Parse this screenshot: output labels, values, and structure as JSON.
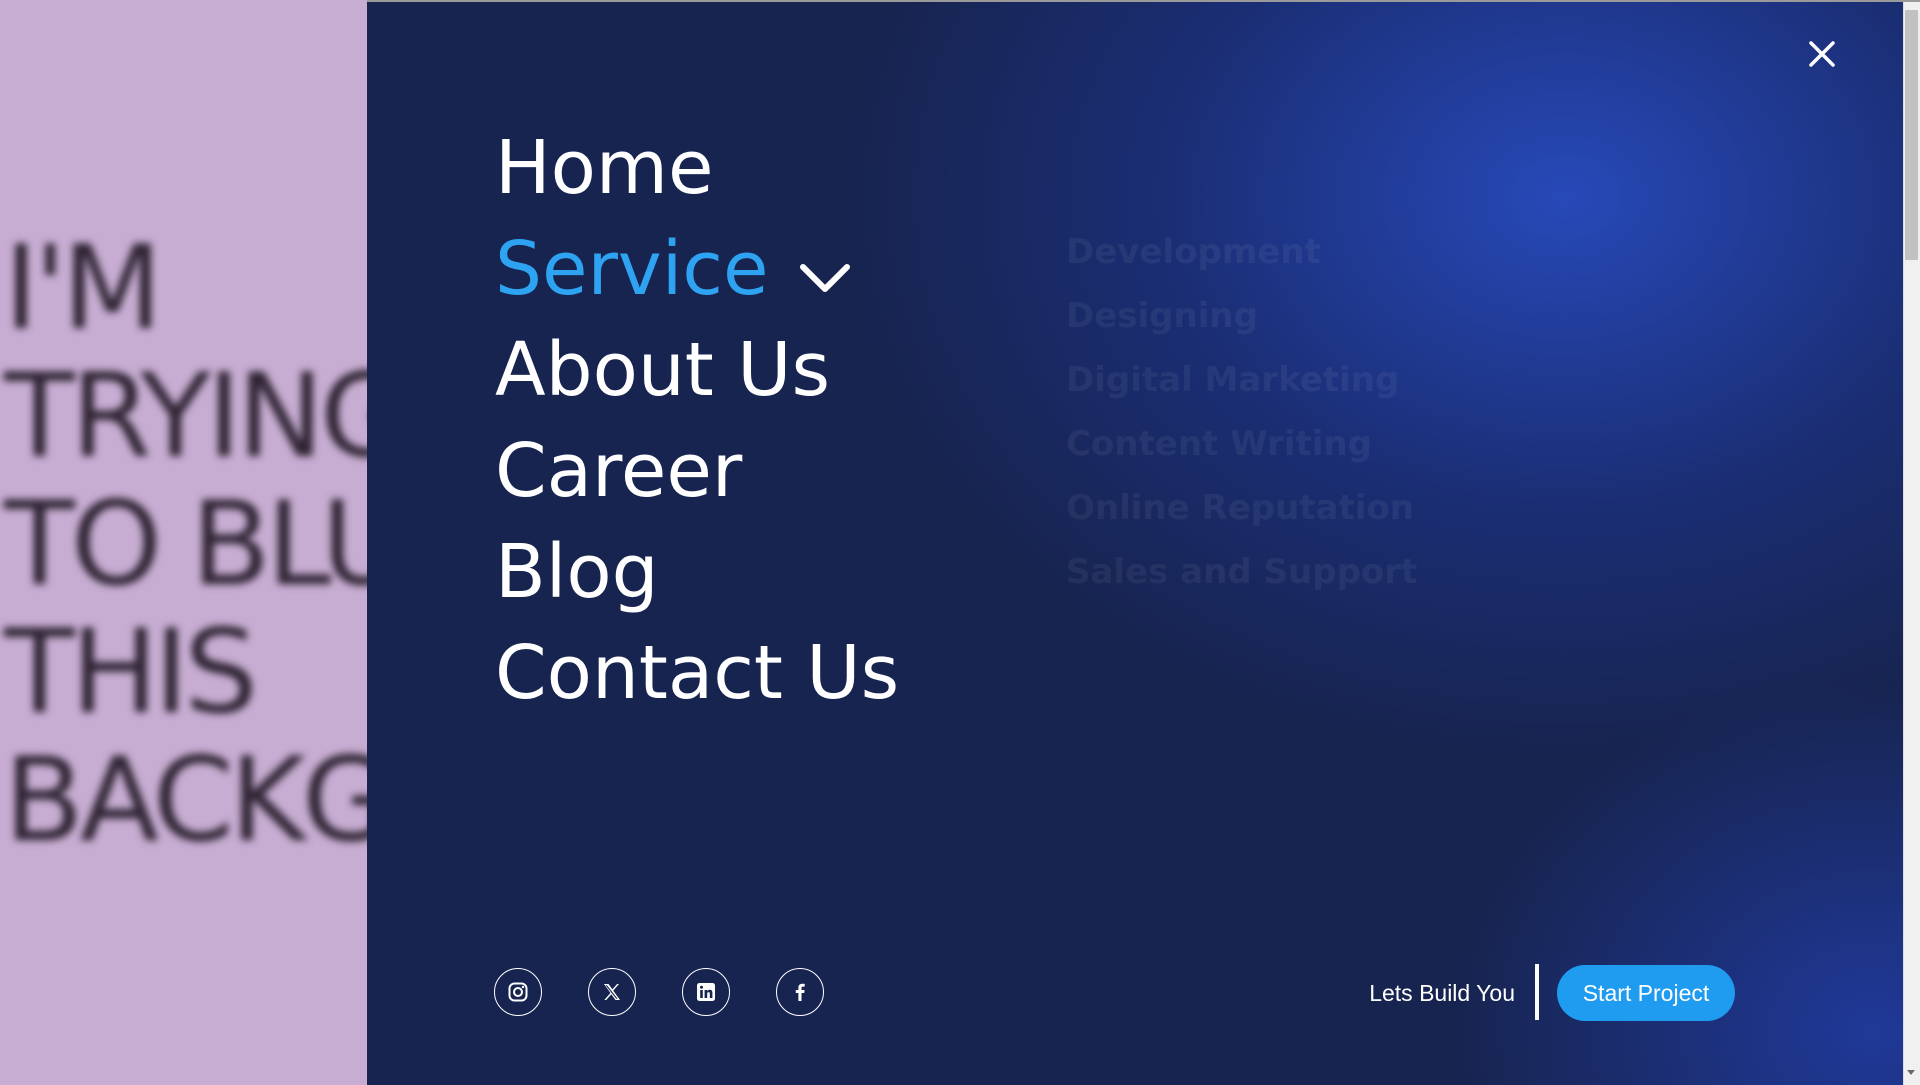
{
  "background": {
    "blurred_text": "I'M\nTRYING\nTO BLUR\nTHIS\nBACKGROUND"
  },
  "menu": {
    "close_icon": "close-icon",
    "nav_items": [
      {
        "label": "Home",
        "active": false
      },
      {
        "label": "Service",
        "active": true,
        "has_dropdown": true
      },
      {
        "label": "About Us",
        "active": false
      },
      {
        "label": "Career",
        "active": false
      },
      {
        "label": "Blog",
        "active": false
      },
      {
        "label": "Contact Us",
        "active": false
      }
    ],
    "service_submenu": [
      "Development",
      "Designing",
      "Digital Marketing",
      "Content Writing",
      "Online Reputation",
      "Sales and Support"
    ]
  },
  "footer": {
    "socials": [
      "instagram-icon",
      "x-icon",
      "linkedin-icon",
      "facebook-icon"
    ],
    "cta_text": "Lets Build You",
    "start_button": "Start Project"
  },
  "colors": {
    "panel_bg": "#172450",
    "accent": "#2ea3f2",
    "button_bg": "#1f9cf0",
    "left_bg": "#c7add2"
  }
}
